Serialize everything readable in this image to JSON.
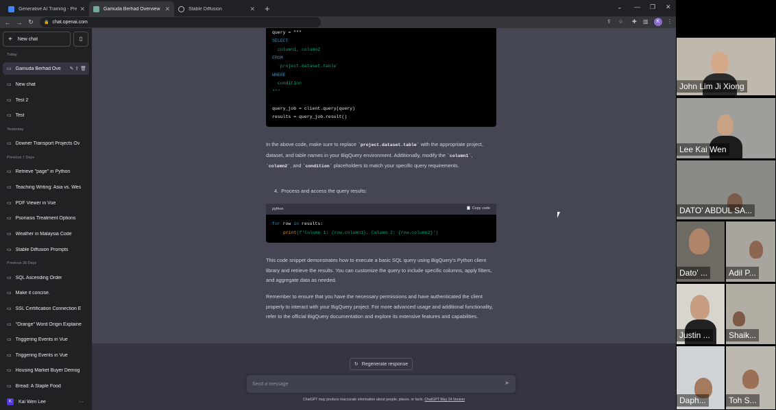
{
  "browser": {
    "tabs": [
      {
        "label": "Generative AI Training - Presenta",
        "active": false
      },
      {
        "label": "Gamuda Berhad Overview",
        "active": true
      },
      {
        "label": "Stable Diffusion",
        "active": false
      }
    ],
    "new_tab": "+",
    "url": "chat.openai.com",
    "profile_initial": "K"
  },
  "sidebar": {
    "new_chat_label": "New chat",
    "sections": {
      "today": "Today",
      "yesterday": "Yesterday",
      "previous7": "Previous 7 Days",
      "previous30": "Previous 30 Days"
    },
    "today_items": [
      "Gamuda Berhad Ove",
      "New chat",
      "Test 2",
      "Test"
    ],
    "yesterday_items": [
      "Downer Transport Projects Ov"
    ],
    "previous7_items": [
      "Retrieve \"page\" in Python",
      "Teaching Writing: Asia vs. Wes",
      "PDF Viewer in Vue",
      "Psoriasis Treatment Options",
      "Weather in Malaysia Code",
      "Stable Diffusion Prompts"
    ],
    "previous30_items": [
      "SQL Ascending Order",
      "Make it concise.",
      "SSL Certification Connection E",
      "\"Orange\" Word Origin Explaine",
      "Triggering Events in Vue",
      "Triggering Events in Vue",
      "Housing Market Buyer Demog",
      "Bread: A Staple Food"
    ],
    "user_name": "Kai Wen Lee",
    "user_initial": "K",
    "more": "···"
  },
  "chat": {
    "code1_lines": [
      "query = \"\"\"",
      "SELECT",
      "  column1, column2",
      "FROM",
      "  `project.dataset.table`",
      "WHERE",
      "  condition",
      "\"\"\"",
      "",
      "query_job = client.query(query)",
      "results = query_job.result()"
    ],
    "para1_pre": "In the above code, make sure to replace ",
    "para1_code1": "`project.dataset.table`",
    "para1_mid": " with the appropriate project, dataset, and table names in your BigQuery environment. Additionally, modify the ",
    "para1_code2": "`column1`",
    "para1_sep1": ", ",
    "para1_code3": "`column2`",
    "para1_sep2": ", and ",
    "para1_code4": "`condition`",
    "para1_post": " placeholders to match your specific query requirements.",
    "step4_num": "4.",
    "step4_text": "Process and access the query results:",
    "code2_lang": "python",
    "code2_copy": "Copy code",
    "code2_line1_kw1": "for",
    "code2_line1_mid": " row ",
    "code2_line1_kw2": "in",
    "code2_line1_end": " results:",
    "code2_line2_fn": "print",
    "code2_line2_str": "(f'Column 1: {row.column1}, Column 2: {row.column2}')",
    "para2": "This code snippet demonstrates how to execute a basic SQL query using BigQuery's Python client library and retrieve the results. You can customize the query to include specific columns, apply filters, and aggregate data as needed.",
    "para3": "Remember to ensure that you have the necessary permissions and have authenticated the client properly to interact with your BigQuery project. For more advanced usage and additional functionality, refer to the official BigQuery documentation and explore its extensive features and capabilities.",
    "regenerate_label": "Regenerate response",
    "composer_placeholder": "Send a message",
    "disclaimer_text": "ChatGPT may produce inaccurate information about people, places, or facts. ",
    "disclaimer_link": "ChatGPT May 24 Version"
  },
  "video": {
    "participants": [
      "John Lim Ji Xiong",
      "Lee Kai Wen",
      "DATO' ABDUL SA...",
      "Dato' ...",
      "Adil P...",
      "Justin ...",
      "Shaik...",
      "Daph...",
      "Toh S..."
    ]
  },
  "colors": {
    "sidebar_bg": "#202123",
    "main_bg": "#343541",
    "message_bg": "#444654",
    "code_bg": "#000000",
    "keyword": "#2e95d3",
    "string": "#00a67d"
  }
}
